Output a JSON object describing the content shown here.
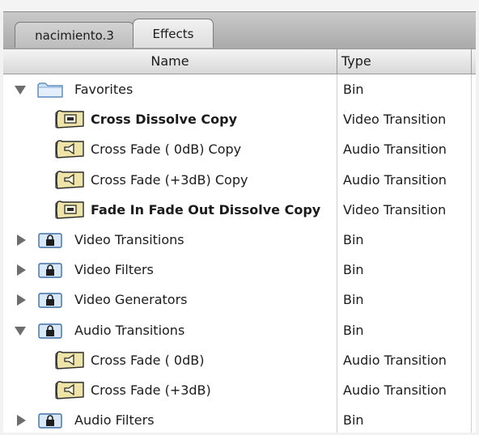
{
  "tabs": [
    {
      "label": "nacimiento.3"
    },
    {
      "label": "Effects"
    }
  ],
  "columns": {
    "name": "Name",
    "type": "Type"
  },
  "rows": [
    {
      "name": "Favorites",
      "type": "Bin",
      "kind": "folder",
      "state": "expanded",
      "bold": false
    },
    {
      "name": "Cross Dissolve Copy",
      "type": "Video Transition",
      "kind": "video",
      "bold": true
    },
    {
      "name": "Cross Fade ( 0dB) Copy",
      "type": "Audio Transition",
      "kind": "audio",
      "bold": false
    },
    {
      "name": "Cross Fade (+3dB) Copy",
      "type": "Audio Transition",
      "kind": "audio",
      "bold": false
    },
    {
      "name": "Fade In Fade Out Dissolve Copy",
      "type": "Video Transition",
      "kind": "video",
      "bold": true
    },
    {
      "name": "Video Transitions",
      "type": "Bin",
      "kind": "locked-bin",
      "state": "collapsed",
      "bold": false
    },
    {
      "name": "Video Filters",
      "type": "Bin",
      "kind": "locked-bin",
      "state": "collapsed",
      "bold": false
    },
    {
      "name": "Video Generators",
      "type": "Bin",
      "kind": "locked-bin",
      "state": "collapsed",
      "bold": false
    },
    {
      "name": "Audio Transitions",
      "type": "Bin",
      "kind": "locked-bin",
      "state": "expanded",
      "bold": false
    },
    {
      "name": "Cross Fade ( 0dB)",
      "type": "Audio Transition",
      "kind": "audio",
      "bold": false
    },
    {
      "name": "Cross Fade (+3dB)",
      "type": "Audio Transition",
      "kind": "audio",
      "bold": false
    },
    {
      "name": "Audio Filters",
      "type": "Bin",
      "kind": "locked-bin",
      "state": "collapsed",
      "bold": false
    }
  ],
  "icons": {
    "folder": "folder-icon",
    "locked-bin": "locked-bin-icon",
    "video": "video-transition-icon",
    "audio": "audio-transition-icon",
    "expanded": "disclosure-expanded-icon",
    "collapsed": "disclosure-collapsed-icon"
  }
}
